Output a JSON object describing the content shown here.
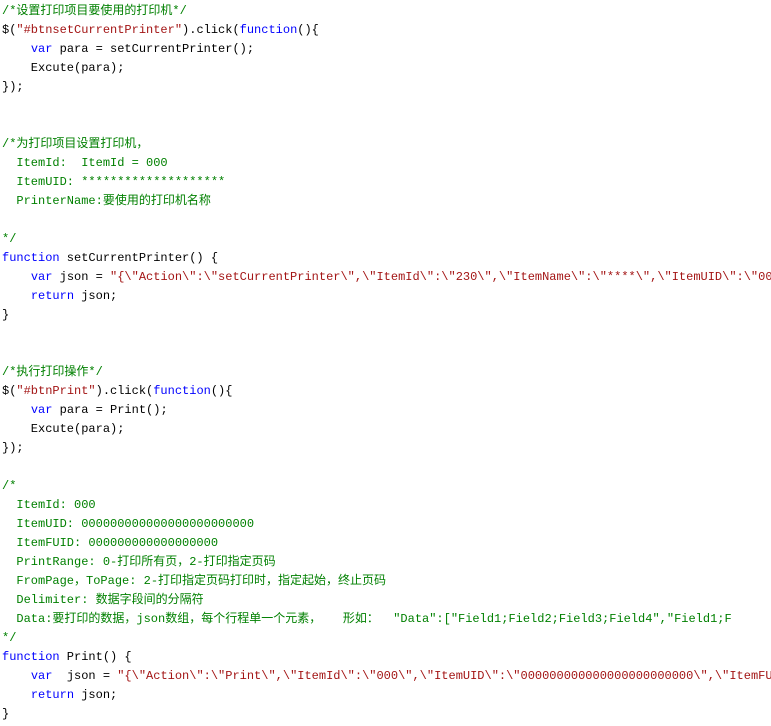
{
  "lines": [
    {
      "type": "cmt",
      "text": "/*设置打印项目要使用的打印机*/"
    },
    {
      "type": "code",
      "tokens": [
        {
          "c": "fn",
          "t": "$"
        },
        {
          "c": "punct",
          "t": "("
        },
        {
          "c": "str",
          "t": "\"#btnsetCurrentPrinter\""
        },
        {
          "c": "punct",
          "t": ").click("
        },
        {
          "c": "kw",
          "t": "function"
        },
        {
          "c": "punct",
          "t": "(){"
        }
      ]
    },
    {
      "type": "code",
      "tokens": [
        {
          "c": "punct",
          "t": "    "
        },
        {
          "c": "kw",
          "t": "var"
        },
        {
          "c": "fn",
          "t": " para = setCurrentPrinter();"
        }
      ]
    },
    {
      "type": "code",
      "tokens": [
        {
          "c": "fn",
          "t": "    Excute(para);"
        }
      ]
    },
    {
      "type": "code",
      "tokens": [
        {
          "c": "fn",
          "t": "});"
        }
      ]
    },
    {
      "type": "blank",
      "text": ""
    },
    {
      "type": "blank",
      "text": ""
    },
    {
      "type": "cmt",
      "text": "/*为打印项目设置打印机，"
    },
    {
      "type": "cmt",
      "text": "  ItemId:  ItemId = 000"
    },
    {
      "type": "cmt",
      "text": "  ItemUID: ********************"
    },
    {
      "type": "cmt",
      "text": "  PrinterName:要使用的打印机名称"
    },
    {
      "type": "blank",
      "text": ""
    },
    {
      "type": "cmt",
      "text": "*/"
    },
    {
      "type": "code",
      "tokens": [
        {
          "c": "kw",
          "t": "function"
        },
        {
          "c": "fn",
          "t": " setCurrentPrinter() {"
        }
      ]
    },
    {
      "type": "code",
      "tokens": [
        {
          "c": "punct",
          "t": "    "
        },
        {
          "c": "kw",
          "t": "var"
        },
        {
          "c": "fn",
          "t": " json = "
        },
        {
          "c": "str",
          "t": "\"{\\\"Action\\\":\\\"setCurrentPrinter\\\",\\\"ItemId\\\":\\\"230\\\",\\\"ItemName\\\":\\\"****\\\",\\\"ItemUID\\\":\\\"000"
        }
      ]
    },
    {
      "type": "code",
      "tokens": [
        {
          "c": "punct",
          "t": "    "
        },
        {
          "c": "kw",
          "t": "return"
        },
        {
          "c": "fn",
          "t": " json;"
        }
      ]
    },
    {
      "type": "code",
      "tokens": [
        {
          "c": "fn",
          "t": "}"
        }
      ]
    },
    {
      "type": "blank",
      "text": ""
    },
    {
      "type": "blank",
      "text": ""
    },
    {
      "type": "cmt",
      "text": "/*执行打印操作*/"
    },
    {
      "type": "code",
      "tokens": [
        {
          "c": "fn",
          "t": "$"
        },
        {
          "c": "punct",
          "t": "("
        },
        {
          "c": "str",
          "t": "\"#btnPrint\""
        },
        {
          "c": "punct",
          "t": ").click("
        },
        {
          "c": "kw",
          "t": "function"
        },
        {
          "c": "punct",
          "t": "(){"
        }
      ]
    },
    {
      "type": "code",
      "tokens": [
        {
          "c": "punct",
          "t": "    "
        },
        {
          "c": "kw",
          "t": "var"
        },
        {
          "c": "fn",
          "t": " para = Print();"
        }
      ]
    },
    {
      "type": "code",
      "tokens": [
        {
          "c": "fn",
          "t": "    Excute(para);"
        }
      ]
    },
    {
      "type": "code",
      "tokens": [
        {
          "c": "fn",
          "t": "});"
        }
      ]
    },
    {
      "type": "blank",
      "text": ""
    },
    {
      "type": "cmt",
      "text": "/*"
    },
    {
      "type": "cmt",
      "text": "  ItemId: 000"
    },
    {
      "type": "cmt",
      "text": "  ItemUID: 000000000000000000000000"
    },
    {
      "type": "cmt",
      "text": "  ItemFUID: 000000000000000000"
    },
    {
      "type": "cmt",
      "text": "  PrintRange: 0-打印所有页，2-打印指定页码"
    },
    {
      "type": "cmt",
      "text": "  FromPage，ToPage: 2-打印指定页码打印时，指定起始，终止页码"
    },
    {
      "type": "cmt",
      "text": "  Delimiter: 数据字段间的分隔符"
    },
    {
      "type": "cmt",
      "text": "  Data:要打印的数据，json数组，每个行程单一个元素，   形如：  \"Data\":[\"Field1;Field2;Field3;Field4\",\"Field1;F"
    },
    {
      "type": "cmt",
      "text": "*/"
    },
    {
      "type": "code",
      "tokens": [
        {
          "c": "kw",
          "t": "function"
        },
        {
          "c": "fn",
          "t": " Print() {"
        }
      ]
    },
    {
      "type": "code",
      "tokens": [
        {
          "c": "punct",
          "t": "    "
        },
        {
          "c": "kw",
          "t": "var"
        },
        {
          "c": "fn",
          "t": "  json = "
        },
        {
          "c": "str",
          "t": "\"{\\\"Action\\\":\\\"Print\\\",\\\"ItemId\\\":\\\"000\\\",\\\"ItemUID\\\":\\\"000000000000000000000000\\\",\\\"ItemFU"
        }
      ]
    },
    {
      "type": "code",
      "tokens": [
        {
          "c": "punct",
          "t": "    "
        },
        {
          "c": "kw",
          "t": "return"
        },
        {
          "c": "fn",
          "t": " json;"
        }
      ]
    },
    {
      "type": "code",
      "tokens": [
        {
          "c": "fn",
          "t": "}"
        }
      ]
    }
  ]
}
